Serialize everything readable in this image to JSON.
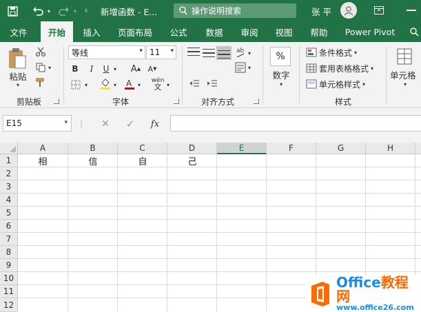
{
  "titlebar": {
    "doc_title": "新增函数 - E...",
    "search_placeholder": "操作说明搜索",
    "user_name": "张 平"
  },
  "tabs": [
    {
      "label": "文件",
      "active": false
    },
    {
      "label": "开始",
      "active": true
    },
    {
      "label": "插入",
      "active": false
    },
    {
      "label": "页面布局",
      "active": false
    },
    {
      "label": "公式",
      "active": false
    },
    {
      "label": "数据",
      "active": false
    },
    {
      "label": "审阅",
      "active": false
    },
    {
      "label": "视图",
      "active": false
    },
    {
      "label": "帮助",
      "active": false
    },
    {
      "label": "Power Pivot",
      "active": false
    }
  ],
  "ribbon": {
    "clipboard": {
      "paste_label": "粘贴",
      "group_label": "剪贴板"
    },
    "font": {
      "font_name": "等线",
      "font_size": "11",
      "bold": "B",
      "italic": "I",
      "underline": "U",
      "grow": "A",
      "shrink": "A",
      "phonetic": "wén",
      "group_label": "字体"
    },
    "alignment": {
      "group_label": "对齐方式"
    },
    "number": {
      "symbol": "%",
      "label": "数字"
    },
    "styles": {
      "conditional": "条件格式",
      "table": "套用表格格式",
      "cell": "单元格样式",
      "group_label": "样式"
    },
    "cells": {
      "label": "单元格"
    }
  },
  "formula_bar": {
    "name_box": "E15",
    "cancel": "✕",
    "enter": "✓",
    "fx": "fx",
    "content": ""
  },
  "sheet": {
    "columns": [
      "A",
      "B",
      "C",
      "D",
      "E",
      "F",
      "G",
      "H"
    ],
    "selected_column": "E",
    "rows": [
      "1",
      "2",
      "3",
      "4",
      "5",
      "6",
      "7",
      "8",
      "9",
      "10",
      "11",
      "12"
    ],
    "cells": {
      "A1": "相",
      "B1": "信",
      "C1": "自",
      "D1": "己"
    }
  },
  "watermark": {
    "brand_a": "Office",
    "brand_b": "教程网",
    "url": "www.office26.com"
  },
  "colors": {
    "accent": "#217346",
    "accent_light": "#5e9a76",
    "watermark_blue": "#1f8be0",
    "watermark_orange": "#ff6a00"
  }
}
